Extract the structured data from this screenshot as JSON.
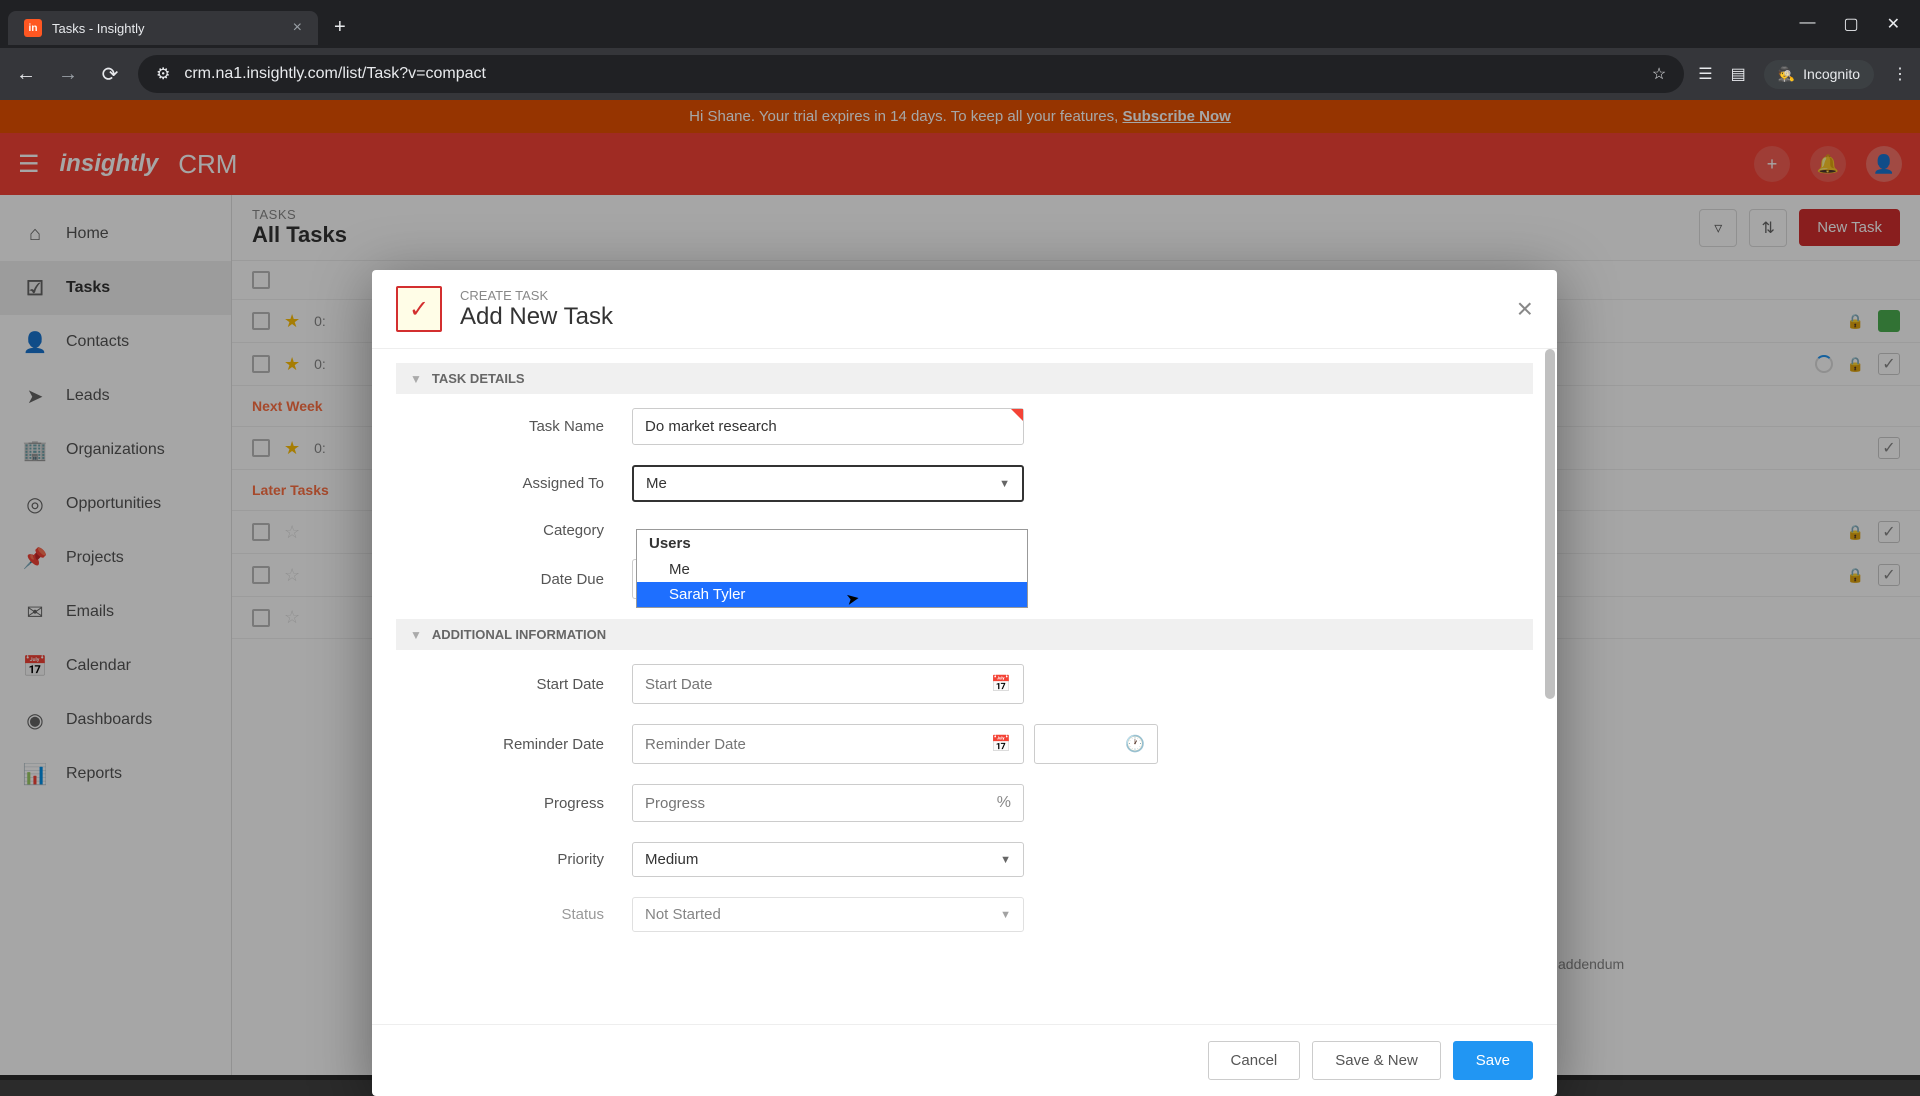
{
  "browser": {
    "tab_title": "Tasks - Insightly",
    "url": "crm.na1.insightly.com/list/Task?v=compact",
    "incognito_label": "Incognito"
  },
  "trial_banner": {
    "greeting": "Hi Shane. Your trial expires in 14 days. To keep all your features, ",
    "link_text": "Subscribe Now"
  },
  "app_header": {
    "logo_text": "insightly",
    "product_label": "CRM"
  },
  "sidebar": {
    "items": [
      {
        "label": "Home",
        "icon": "⌂"
      },
      {
        "label": "Tasks",
        "icon": "✓",
        "active": true
      },
      {
        "label": "Contacts",
        "icon": "👤"
      },
      {
        "label": "Leads",
        "icon": "➜"
      },
      {
        "label": "Organizations",
        "icon": "🏢"
      },
      {
        "label": "Opportunities",
        "icon": "◎"
      },
      {
        "label": "Projects",
        "icon": "📌"
      },
      {
        "label": "Emails",
        "icon": "✉"
      },
      {
        "label": "Calendar",
        "icon": "📅"
      },
      {
        "label": "Dashboards",
        "icon": "📊"
      },
      {
        "label": "Reports",
        "icon": "📈"
      }
    ]
  },
  "content": {
    "subtitle": "TASKS",
    "title": "All Tasks",
    "new_task_button": "New Task",
    "sections": {
      "next_week": "Next Week",
      "later_tasks": "Later Tasks"
    },
    "rows_preview": [
      "0:",
      "0:",
      "0:"
    ],
    "footer_text": "addendum"
  },
  "modal": {
    "subtitle": "CREATE TASK",
    "title": "Add New Task",
    "sections": {
      "task_details": "TASK DETAILS",
      "additional_info": "ADDITIONAL INFORMATION"
    },
    "fields": {
      "task_name": {
        "label": "Task Name",
        "value": "Do market research"
      },
      "assigned_to": {
        "label": "Assigned To",
        "value": "Me"
      },
      "category": {
        "label": "Category"
      },
      "date_due": {
        "label": "Date Due",
        "placeholder": "Date Due"
      },
      "start_date": {
        "label": "Start Date",
        "placeholder": "Start Date"
      },
      "reminder_date": {
        "label": "Reminder Date",
        "placeholder": "Reminder Date"
      },
      "progress": {
        "label": "Progress",
        "placeholder": "Progress"
      },
      "priority": {
        "label": "Priority",
        "value": "Medium"
      },
      "status": {
        "label": "Status",
        "value": "Not Started"
      }
    },
    "dropdown": {
      "group_label": "Users",
      "options": [
        "Me",
        "Sarah Tyler"
      ]
    },
    "buttons": {
      "cancel": "Cancel",
      "save_new": "Save & New",
      "save": "Save"
    }
  }
}
